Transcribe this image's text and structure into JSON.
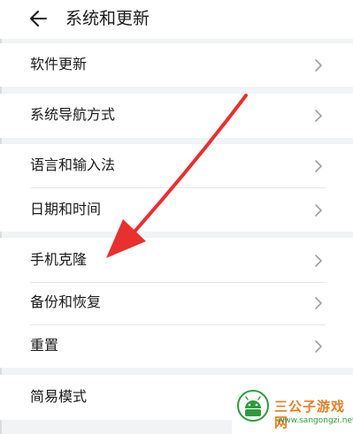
{
  "header": {
    "title": "系统和更新",
    "back_icon": "back-arrow-icon"
  },
  "groups": [
    {
      "items": [
        {
          "label": "软件更新"
        }
      ]
    },
    {
      "items": [
        {
          "label": "系统导航方式"
        }
      ]
    },
    {
      "items": [
        {
          "label": "语言和输入法"
        },
        {
          "label": "日期和时间"
        }
      ]
    },
    {
      "items": [
        {
          "label": "手机克隆"
        },
        {
          "label": "备份和恢复"
        },
        {
          "label": "重置"
        }
      ]
    },
    {
      "items": [
        {
          "label": "简易模式"
        }
      ]
    }
  ],
  "chevron_icon": "chevron-right-icon",
  "annotation": {
    "icon": "red-arrow-icon",
    "color": "#e8302f"
  },
  "watermark": {
    "title": "三公子游戏网",
    "url": "www.sangongzi.net"
  },
  "colors": {
    "background": "#f1f3f5",
    "card": "#ffffff",
    "text": "#1a1a1a",
    "chevron": "#a0a0a0"
  }
}
